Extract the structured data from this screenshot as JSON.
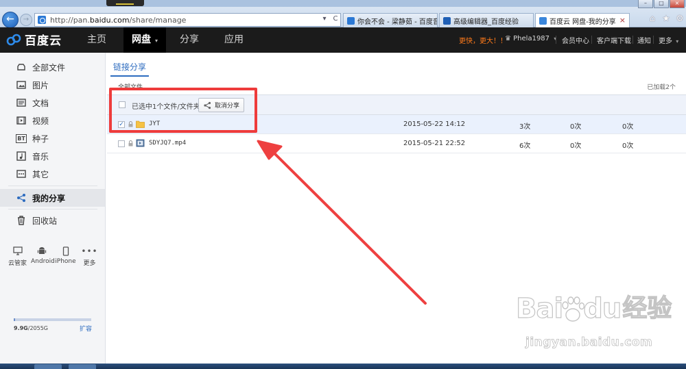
{
  "browser": {
    "url_prefix": "http://pan.",
    "url_domain": "baidu.com",
    "url_path": "/share/manage",
    "tabs": [
      {
        "title": "你会不会 - 梁静茹 - 百度音..."
      },
      {
        "title": "高级编辑器_百度经验"
      },
      {
        "title": "百度云 网盘-我的分享",
        "close": "×"
      }
    ],
    "back": "←",
    "forward": "→",
    "address_controls": [
      "▾",
      "C"
    ],
    "window_buttons": [
      "–",
      "□",
      "×"
    ],
    "toolbar_icons": [
      "⌂",
      "★",
      "⚙"
    ]
  },
  "header": {
    "logo_text": "百度云",
    "nav": [
      {
        "label": "主页"
      },
      {
        "label": "网盘",
        "caret": "▾"
      },
      {
        "label": "分享"
      },
      {
        "label": "应用"
      }
    ],
    "promo": "更快，更大！！",
    "user": "Phela1987",
    "user_caret": "▾",
    "links": [
      "会员中心",
      "客户端下载",
      "通知",
      "更多"
    ],
    "more_caret": "▾"
  },
  "sidebar": {
    "items": [
      {
        "label": "全部文件",
        "icon": "cloud-icon"
      },
      {
        "label": "图片",
        "icon": "image-icon"
      },
      {
        "label": "文档",
        "icon": "document-icon"
      },
      {
        "label": "视频",
        "icon": "video-icon"
      },
      {
        "label": "种子",
        "icon": "bt-icon",
        "icon_text": "BT"
      },
      {
        "label": "音乐",
        "icon": "music-icon"
      },
      {
        "label": "其它",
        "icon": "more-icon"
      },
      {
        "label": "我的分享",
        "icon": "share-icon"
      },
      {
        "label": "回收站",
        "icon": "trash-icon"
      }
    ],
    "devices": [
      {
        "label": "云管家",
        "icon": "monitor-icon"
      },
      {
        "label": "Android",
        "icon": "android-icon"
      },
      {
        "label": "iPhone",
        "icon": "phone-icon"
      },
      {
        "label": "更多",
        "icon": "ellipsis-icon"
      }
    ],
    "quota_used": "9.9G",
    "quota_total": "/2055G",
    "quota_fraction": 0.005,
    "expand_label": "扩容"
  },
  "main": {
    "tab": "链接分享",
    "breadcrumb": "全部文件",
    "loaded": "已加载2个",
    "toolbar": {
      "selected_text": "已选中1个文件/文件夹",
      "cancel_share": "取消分享"
    },
    "files": [
      {
        "name": "JYT",
        "type": "folder",
        "date": "2015-05-22 14:12",
        "c1": "3次",
        "c2": "0次",
        "c3": "0次",
        "checked": "✓"
      },
      {
        "name": "SDYJQ7.mp4",
        "type": "video",
        "date": "2015-05-21 22:52",
        "c1": "6次",
        "c2": "0次",
        "c3": "0次",
        "checked": ""
      }
    ]
  },
  "watermark": {
    "brand": "Bai",
    "brand_tail": "du",
    "cn": "经验",
    "url": "jingyan.baidu.com"
  },
  "colors": {
    "accent": "#2c6bbf",
    "annotation": "#ee3b3b",
    "promo": "#ff7a1a",
    "header_bg": "#1b1b1b"
  }
}
